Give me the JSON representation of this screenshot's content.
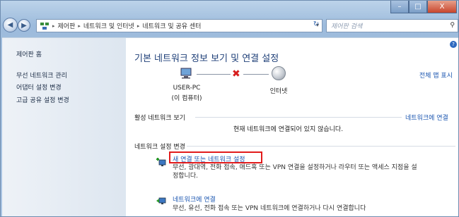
{
  "caption_buttons": {
    "minimize": "–",
    "maximize": "□",
    "close": "X"
  },
  "nav": {
    "back": "◀",
    "forward": "▶"
  },
  "address": {
    "crumbs": [
      "제어판",
      "네트워크 및 인터넷",
      "네트워크 및 공유 센터"
    ],
    "separator": "▸",
    "dropdown": "▾"
  },
  "refresh": "↻",
  "search": {
    "placeholder": "제어판 검색",
    "icon": "⚲"
  },
  "left_panel": {
    "home": "제어판 홈",
    "items": [
      "무선 네트워크 관리",
      "어댑터 설정 변경",
      "고급 공유 설정 변경"
    ]
  },
  "main": {
    "title": "기본 네트워크 정보 보기 및 연결 설정",
    "full_map": "전체 맵 표시",
    "pc_name": "USER-PC",
    "pc_sub": "(이 컴퓨터)",
    "internet": "인터넷",
    "active_label": "활성 네트워크 보기",
    "connect_link": "네트워크에 연결",
    "not_connected": "현재 네트워크에 연결되어 있지 않습니다.",
    "change_label": "네트워크 설정 변경",
    "new_conn_link": "새 연결 또는 네트워크 설정",
    "new_conn_desc1": "무선, 광대역, 전화 접속, 애드혹 또는 VPN 연결을 설정하거나 라우터 또는 액세스 지점을 설",
    "new_conn_desc2": "정합니다.",
    "connect_net_link": "네트워크에 연결",
    "connect_net_desc": "무선, 유선, 전화 접속 또는 VPN 네트워크에 연결하거나 다시 연결합니다"
  },
  "colors": {
    "link": "#1a55b0",
    "highlight": "#e21b1b",
    "title": "#1e3f78"
  }
}
